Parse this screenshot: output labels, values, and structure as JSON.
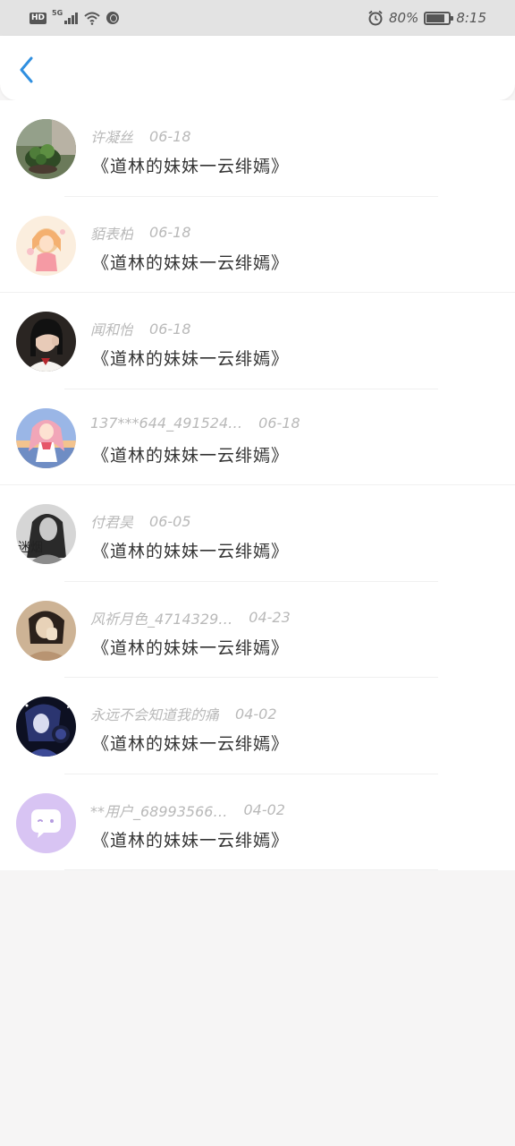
{
  "status_bar": {
    "hd": "HD",
    "network": "5G",
    "battery_text": "80%",
    "battery_level": 0.8,
    "time": "8:15",
    "icons": [
      "hd-icon",
      "signal-icon",
      "wifi-icon",
      "globe-icon",
      "alarm-icon",
      "battery-icon"
    ]
  },
  "header": {
    "back_icon": "chevron-left-icon",
    "accent_color": "#2f8fe0"
  },
  "list": [
    {
      "name": "许凝丝",
      "date": "06-18",
      "content": "《道林的妹妹一云绯嫣》",
      "avatar": "plant"
    },
    {
      "name": "貊表柏",
      "date": "06-18",
      "content": "《道林的妹妹一云绯嫣》",
      "avatar": "anime-girl-pink"
    },
    {
      "name": "闻和怡",
      "date": "06-18",
      "content": "《道林的妹妹一云绯嫣》",
      "avatar": "girl-photo"
    },
    {
      "name": "137***644_491524…",
      "date": "06-18",
      "content": "《道林的妹妹一云绯嫣》",
      "avatar": "anime-girl-sky"
    },
    {
      "name": "付君昊",
      "date": "06-05",
      "content": "《道林的妹妹一云绯嫣》",
      "avatar": "bw-girl",
      "avatar_text": "迷烟"
    },
    {
      "name": "风祈月色_4714329…",
      "date": "04-23",
      "content": "《道林的妹妹一云绯嫣》",
      "avatar": "sepia-girl"
    },
    {
      "name": "永远不会知道我的痛",
      "date": "04-02",
      "content": "《道林的妹妹一云绯嫣》",
      "avatar": "dark-anime"
    },
    {
      "name": "**用户_68993566…",
      "date": "04-02",
      "content": "《道林的妹妹一云绯嫣》",
      "avatar": "default-chat"
    }
  ]
}
